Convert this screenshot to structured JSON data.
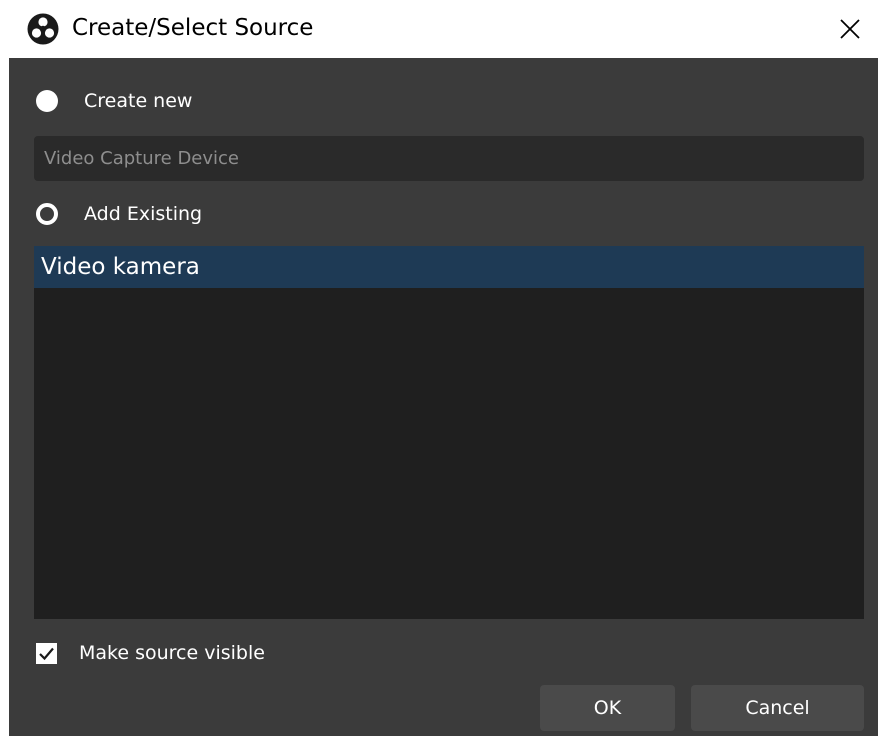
{
  "window": {
    "title": "Create/Select Source",
    "icon": "obs-logo-icon",
    "close_icon": "close-icon"
  },
  "create_new": {
    "label": "Create new",
    "selected": true,
    "name_value": "Video Capture Device"
  },
  "add_existing": {
    "label": "Add Existing",
    "selected": false,
    "items": [
      {
        "label": "Video kamera",
        "selected": true
      }
    ]
  },
  "visible_checkbox": {
    "label": "Make source visible",
    "checked": true
  },
  "buttons": {
    "ok": "OK",
    "cancel": "Cancel"
  },
  "colors": {
    "body_bg": "#3b3b3b",
    "input_bg": "#2a2a2a",
    "list_bg": "#1f1f1f",
    "selection": "#1e3a55",
    "button_bg": "#4a4a4a"
  }
}
